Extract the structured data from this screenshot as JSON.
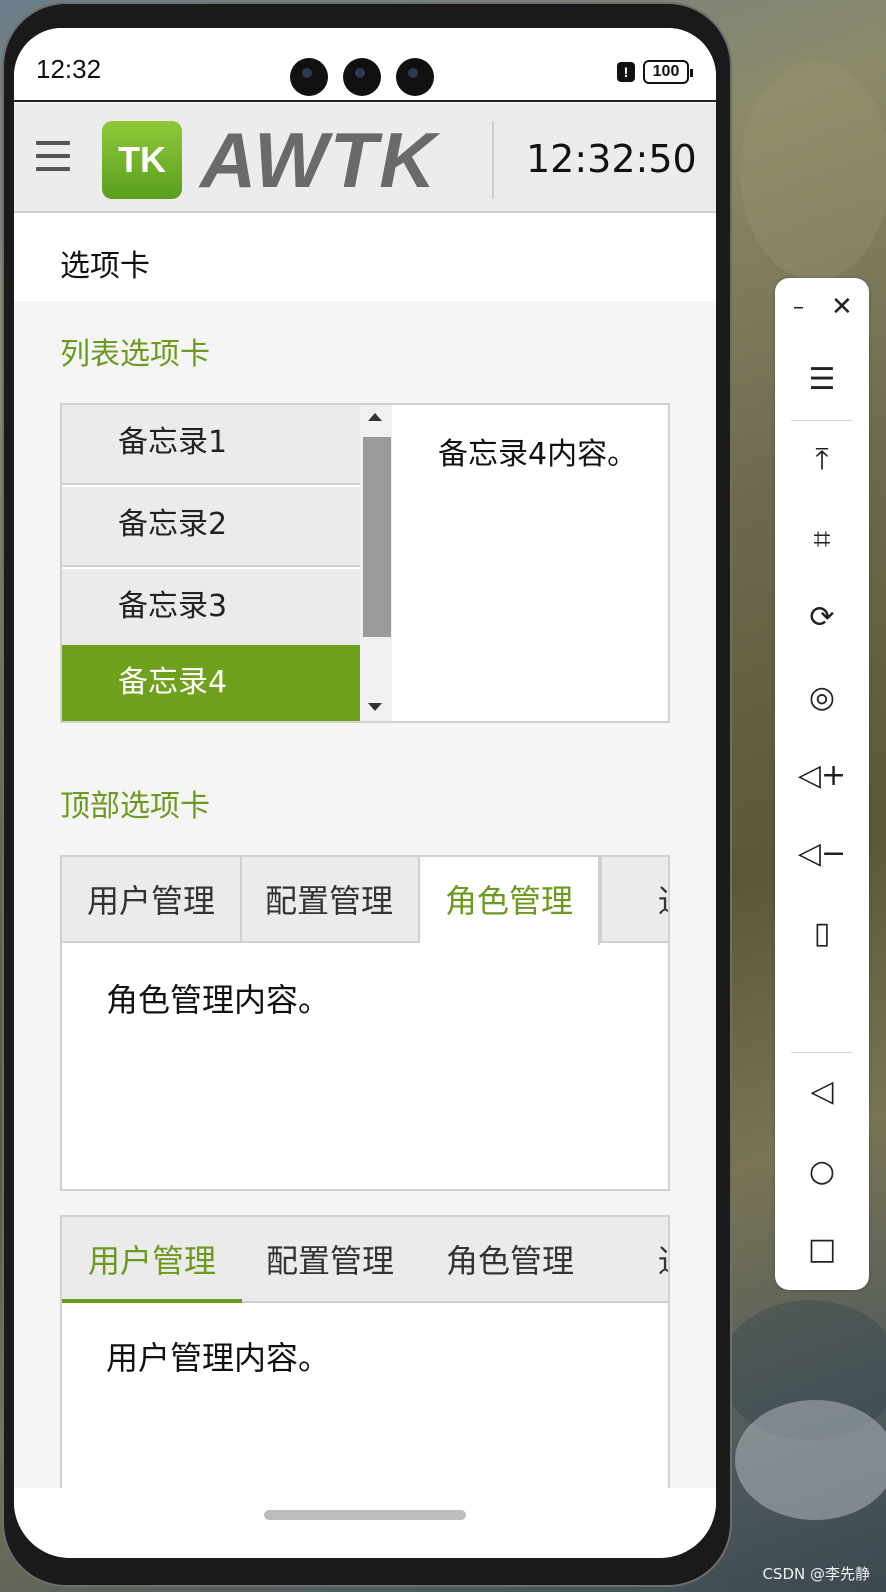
{
  "status_bar": {
    "time": "12:32",
    "battery": "100"
  },
  "header": {
    "logo_mark": "TK",
    "logo_text": "AWTK",
    "clock": "12:32:50"
  },
  "page": {
    "title": "选项卡"
  },
  "list_tabs": {
    "section_title": "列表选项卡",
    "items": [
      {
        "label": "备忘录1",
        "active": false
      },
      {
        "label": "备忘录2",
        "active": false
      },
      {
        "label": "备忘录3",
        "active": false
      },
      {
        "label": "备忘录4",
        "active": true
      }
    ],
    "content": "备忘录4内容。"
  },
  "top_tabs": {
    "section_title": "顶部选项卡",
    "tabs": [
      "用户管理",
      "配置管理",
      "角色管理",
      "通用"
    ],
    "active_index": 2,
    "content": "角色管理内容。"
  },
  "flat_tabs": {
    "tabs": [
      "用户管理",
      "配置管理",
      "角色管理",
      "通用"
    ],
    "active_index": 0,
    "content": "用户管理内容。"
  },
  "toolbar": {
    "buttons": [
      "menu-icon",
      "pin-top-icon",
      "crop-icon",
      "rotate-lock-icon",
      "screen-record-icon",
      "volume-up-icon",
      "volume-down-icon",
      "rotate-icon",
      "back-icon",
      "home-icon",
      "recent-apps-icon"
    ]
  },
  "watermark": "CSDN @李先静",
  "colors": {
    "accent": "#6b9a1f",
    "active_bg": "#6fa11c"
  }
}
